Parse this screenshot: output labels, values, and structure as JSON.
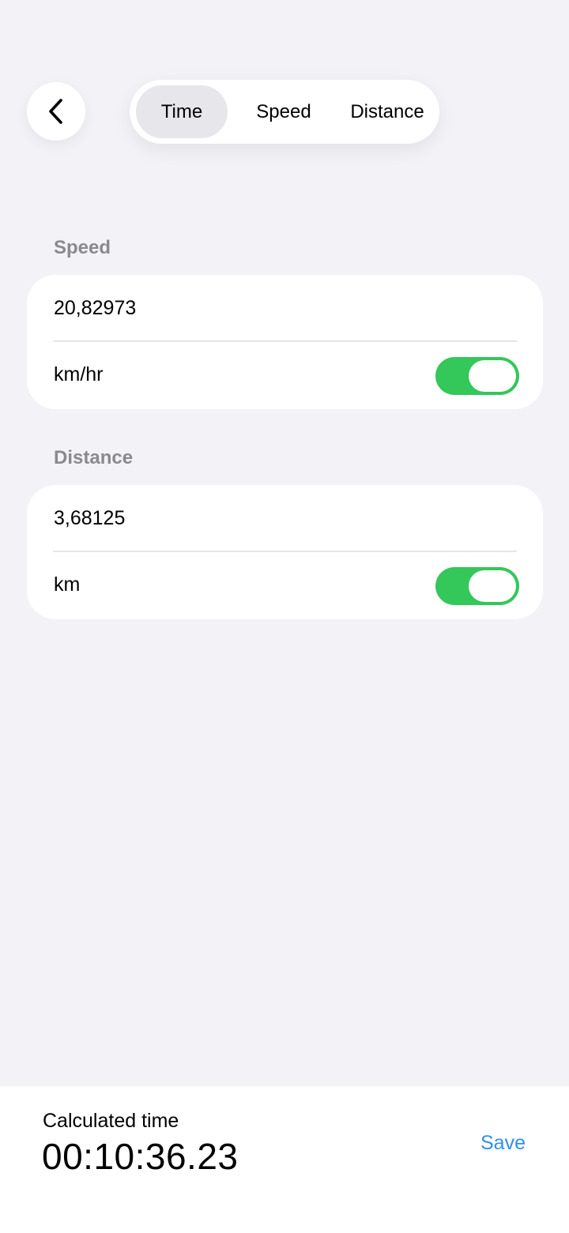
{
  "header": {
    "back_icon": "chevron-left-icon",
    "tabs": [
      {
        "label": "Time",
        "selected": true
      },
      {
        "label": "Speed",
        "selected": false
      },
      {
        "label": "Distance",
        "selected": false
      }
    ]
  },
  "speed": {
    "label": "Speed",
    "value": "20,82973",
    "unit": "km/hr",
    "toggle_on": true
  },
  "distance": {
    "label": "Distance",
    "value": "3,68125",
    "unit": "km",
    "toggle_on": true
  },
  "result": {
    "label": "Calculated time",
    "value": "00:10:36.23",
    "save_label": "Save"
  },
  "colors": {
    "toggle_on": "#34c759",
    "accent": "#2f8ef0",
    "background": "#f2f2f7"
  }
}
